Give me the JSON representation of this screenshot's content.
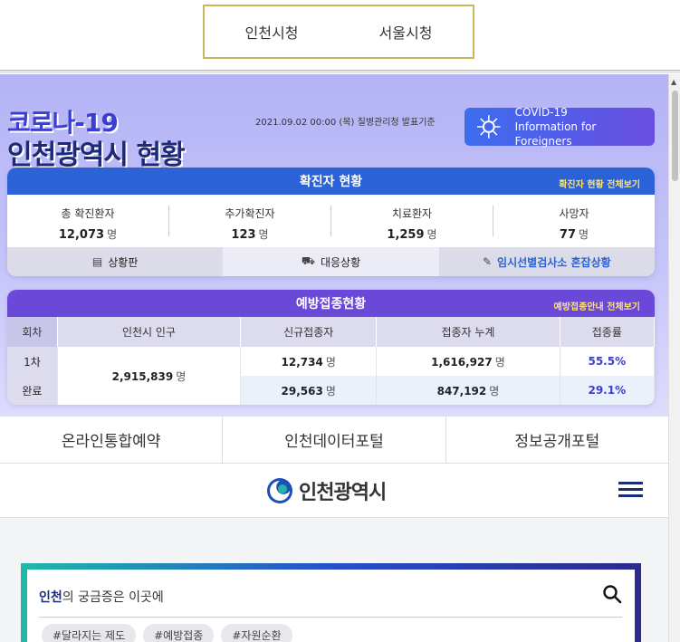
{
  "city_select": {
    "incheon": "인천시청",
    "seoul": "서울시청"
  },
  "covid": {
    "title_line1": "코로나-19",
    "title_line2": "인천광역시 현황",
    "date": "2021.09.02 00:00 (목) 질병관리청 발표기준",
    "foreign_line1": "COVID-19",
    "foreign_line2": "Information for Foreigners",
    "confirmed": {
      "title": "확진자 현황",
      "more": "확진자 현황 전체보기",
      "stats": [
        {
          "label": "총 확진환자",
          "value": "12,073",
          "unit": "명"
        },
        {
          "label": "추가확진자",
          "value": "123",
          "unit": "명"
        },
        {
          "label": "치료환자",
          "value": "1,259",
          "unit": "명"
        },
        {
          "label": "사망자",
          "value": "77",
          "unit": "명"
        }
      ],
      "tabs": [
        "상황판",
        "대응상황",
        "임시선별검사소 혼잡상황"
      ]
    },
    "vaccine": {
      "title": "예방접종현황",
      "more": "예방접종안내 전체보기",
      "headers": [
        "회차",
        "인천시 인구",
        "신규접종자",
        "접종자 누계",
        "접종률"
      ],
      "population": "2,915,839",
      "unit": "명",
      "rows": [
        {
          "label": "1차",
          "new": "12,734",
          "total": "1,616,927",
          "rate": "55.5%"
        },
        {
          "label": "완료",
          "new": "29,563",
          "total": "847,192",
          "rate": "29.1%"
        }
      ]
    }
  },
  "quick_links": [
    "온라인통합예약",
    "인천데이터포털",
    "정보공개포털"
  ],
  "header": {
    "logo_text": "인천광역시"
  },
  "search": {
    "title_bold": "인천",
    "title_rest": "의 궁금증은 이곳에",
    "tags": [
      "#달라지는 제도",
      "#예방접종",
      "#자원순환"
    ]
  },
  "colors": {
    "primary": "#2b62d6",
    "vaccine": "#6a48d8",
    "accent": "#3b3fd1",
    "link_yellow": "#ffe36a"
  }
}
